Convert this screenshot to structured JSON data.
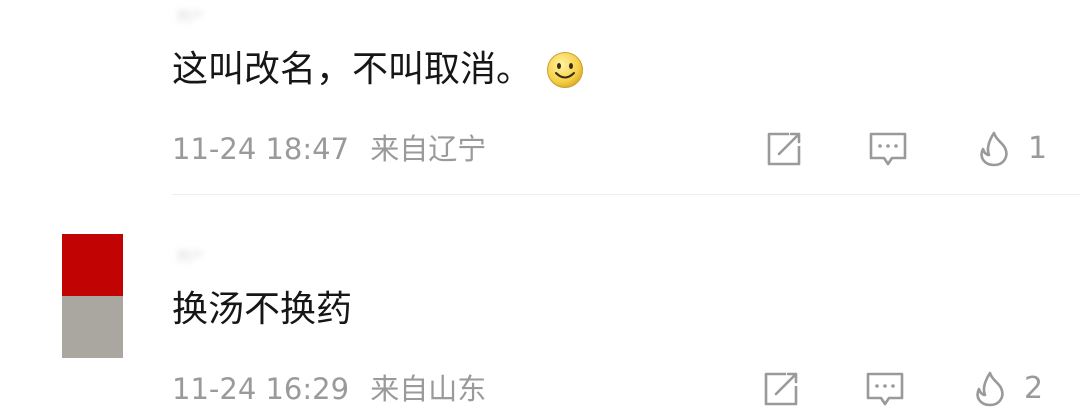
{
  "comments": [
    {
      "username": "用户",
      "text": "这叫改名，不叫取消。",
      "emoji": "smile-emoji",
      "date": "11-24 18:47",
      "location": "来自辽宁",
      "likes": "1"
    },
    {
      "username": "用户",
      "avatar_colors": [
        "#c20303",
        "#a9a7a0"
      ],
      "text": "换汤不换药",
      "date": "11-24 16:29",
      "location": "来自山东",
      "likes": "2"
    }
  ],
  "icons": {
    "share": "share-icon",
    "reply": "comment-icon",
    "like": "flame-icon"
  }
}
